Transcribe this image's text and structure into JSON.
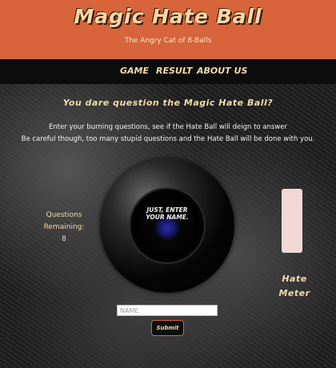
{
  "header": {
    "title": "Magic Hate Ball",
    "subtitle": "The Angry Cat of 8-Balls"
  },
  "nav": {
    "items": [
      "GAME",
      "RESULT",
      "ABOUT US"
    ]
  },
  "main": {
    "question": "You dare question the Magic Hate Ball?",
    "intro_line1": "Enter your burning questions, see if the Hate Ball will deign to answer",
    "intro_line2": "Be careful though, too many stupid questions and the Hate Ball will be done with you.",
    "remaining_label_1": "Questions",
    "remaining_label_2": "Remaining:",
    "remaining_count": "8",
    "ball_message_line1": "JUST, ENTER",
    "ball_message_line2": "YOUR NAME.",
    "hate_meter_label_1": "Hate",
    "hate_meter_label_2": "Meter",
    "name_placeholder": "NAME",
    "submit_label": "Submit"
  },
  "colors": {
    "header_bg": "#d7643a",
    "accent_text": "#f6d9a8",
    "nav_bg": "#0c0c0c",
    "meter_fill": "#f2d9d3"
  }
}
